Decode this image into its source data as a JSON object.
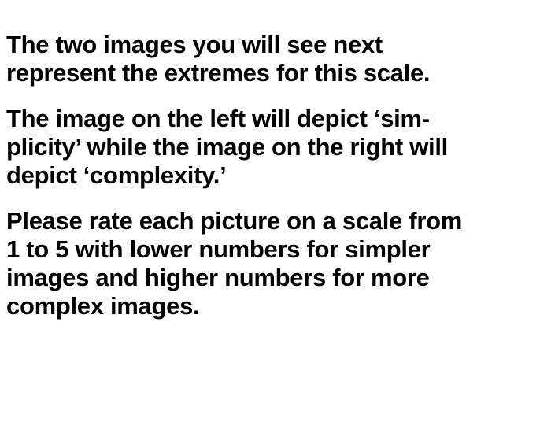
{
  "instructions": {
    "paragraph_1": {
      "line_1": "The two images you will see next",
      "line_2": "represent the extremes for this scale."
    },
    "paragraph_2": {
      "line_1": "The image on the left will depict ‘sim-",
      "line_2": "plicity’ while the image on the right will",
      "line_3": "depict ‘complexity.’"
    },
    "paragraph_3": {
      "line_1": "Please rate each picture on a scale from",
      "line_2": "1 to 5 with lower numbers for simpler",
      "line_3": "images and higher numbers for more",
      "line_4": "complex images."
    }
  }
}
